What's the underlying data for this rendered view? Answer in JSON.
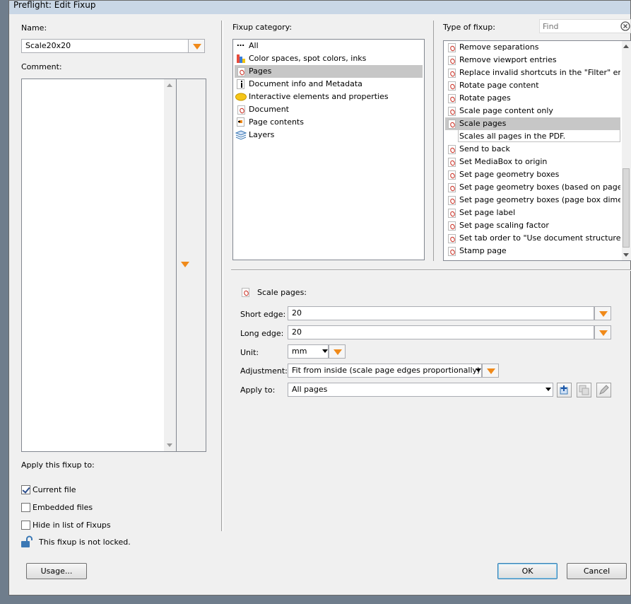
{
  "window": {
    "title": "Preflight: Edit Fixup"
  },
  "left": {
    "name_label": "Name:",
    "name_value": "Scale20x20",
    "comment_label": "Comment:",
    "apply_label": "Apply this fixup to:",
    "checkboxes": [
      {
        "label": "Current file",
        "checked": true
      },
      {
        "label": "Embedded files",
        "checked": false
      },
      {
        "label": "Hide in list of Fixups",
        "checked": false
      }
    ],
    "lock_text": "This fixup is not locked."
  },
  "category": {
    "label": "Fixup category:",
    "items": [
      {
        "label": "All",
        "icon": "ellipsis-icon"
      },
      {
        "label": "Color spaces, spot colors, inks",
        "icon": "color-palette-icon"
      },
      {
        "label": "Pages",
        "icon": "pdf-icon"
      },
      {
        "label": "Document info and Metadata",
        "icon": "info-icon"
      },
      {
        "label": "Interactive elements and properties",
        "icon": "comment-icon"
      },
      {
        "label": "Document",
        "icon": "pdf-icon"
      },
      {
        "label": "Page contents",
        "icon": "page-contents-icon"
      },
      {
        "label": "Layers",
        "icon": "layers-icon"
      }
    ],
    "selected": "Pages"
  },
  "type": {
    "label": "Type of fixup:",
    "find_placeholder": "Find",
    "items": [
      "Remove separations",
      "Remove viewport entries",
      "Replace invalid shortcuts in the \"Filter\" entry",
      "Rotate page content",
      "Rotate pages",
      "Scale page content only",
      "Scale pages",
      "Send to back",
      "Set MediaBox to origin",
      "Set page geometry boxes",
      "Set page geometry boxes (based on page cor",
      "Set page geometry boxes (page box dimensic",
      "Set page label",
      "Set page scaling factor",
      "Set tab order to \"Use document structure\"",
      "Stamp page"
    ],
    "selected": "Scale pages",
    "selected_description": "Scales all pages in the PDF."
  },
  "details": {
    "heading": "Scale pages:",
    "short_edge_label": "Short edge:",
    "short_edge_value": "20",
    "long_edge_label": "Long edge:",
    "long_edge_value": "20",
    "unit_label": "Unit:",
    "unit_value": "mm",
    "adjustment_label": "Adjustment:",
    "adjustment_value": "Fit from inside (scale page edges proportionally)",
    "apply_to_label": "Apply to:",
    "apply_to_value": "All pages"
  },
  "buttons": {
    "usage": "Usage...",
    "ok": "OK",
    "cancel": "Cancel"
  },
  "colors": {
    "accent": "#f08a1a",
    "selection": "#c7c7c7"
  }
}
